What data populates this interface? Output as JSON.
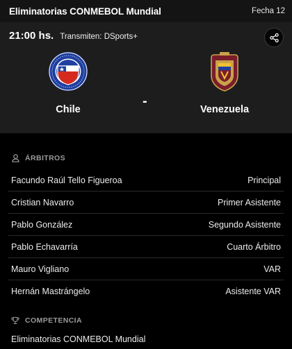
{
  "header": {
    "competition": "Eliminatorias CONMEBOL Mundial",
    "round": "Fecha 12"
  },
  "match": {
    "time": "21:00 hs.",
    "broadcast": "Transmiten: DSports+",
    "separator": "-",
    "home": {
      "name": "Chile",
      "crest_icon": "chile-crest-icon"
    },
    "away": {
      "name": "Venezuela",
      "crest_icon": "venezuela-crest-icon"
    }
  },
  "referees": {
    "title": "ÁRBITROS",
    "icon": "person-icon",
    "rows": [
      {
        "name": "Facundo Raúl Tello Figueroa",
        "role": "Principal"
      },
      {
        "name": "Cristian Navarro",
        "role": "Primer Asistente"
      },
      {
        "name": "Pablo González",
        "role": "Segundo Asistente"
      },
      {
        "name": "Pablo Echavarría",
        "role": "Cuarto Árbitro"
      },
      {
        "name": "Mauro Vigliano",
        "role": "VAR"
      },
      {
        "name": "Hernán Mastrángelo",
        "role": "Asistente VAR"
      }
    ]
  },
  "competition": {
    "title": "COMPETENCIA",
    "icon": "trophy-icon",
    "value": "Eliminatorias CONMEBOL Mundial"
  }
}
